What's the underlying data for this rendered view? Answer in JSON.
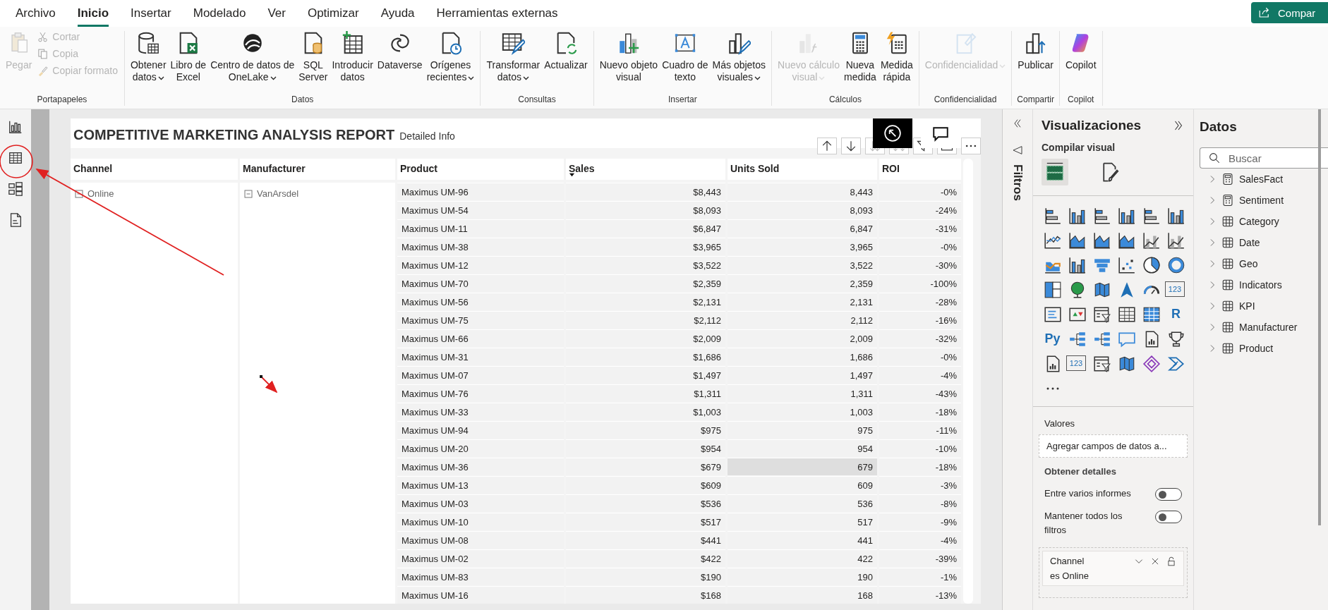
{
  "menu": {
    "tabs": [
      {
        "label": "Archivo",
        "selected": false
      },
      {
        "label": "Inicio",
        "selected": true
      },
      {
        "label": "Insertar",
        "selected": false
      },
      {
        "label": "Modelado",
        "selected": false
      },
      {
        "label": "Ver",
        "selected": false
      },
      {
        "label": "Optimizar",
        "selected": false
      },
      {
        "label": "Ayuda",
        "selected": false
      },
      {
        "label": "Herramientas externas",
        "selected": false
      }
    ],
    "share_button": "Compar"
  },
  "ribbon": {
    "groups": [
      {
        "label": "Portapapeles",
        "buttons": [
          {
            "lines": [
              "Pegar"
            ],
            "kind": "large",
            "disabled": true,
            "dropdown": false
          },
          {
            "lines": [
              "Cortar"
            ],
            "kind": "small",
            "disabled": true,
            "dropdown": false
          },
          {
            "lines": [
              "Copia"
            ],
            "kind": "small",
            "disabled": true,
            "dropdown": false
          },
          {
            "lines": [
              "Copiar formato"
            ],
            "kind": "small",
            "disabled": true,
            "dropdown": false
          }
        ]
      },
      {
        "label": "Datos",
        "buttons": [
          {
            "lines": [
              "Obtener",
              "datos"
            ],
            "kind": "large",
            "disabled": false,
            "dropdown": true
          },
          {
            "lines": [
              "Libro de",
              "Excel"
            ],
            "kind": "large",
            "disabled": false,
            "dropdown": false
          },
          {
            "lines": [
              "Centro de datos de",
              "OneLake"
            ],
            "kind": "large",
            "disabled": false,
            "dropdown": true
          },
          {
            "lines": [
              "SQL",
              "Server"
            ],
            "kind": "large",
            "disabled": false,
            "dropdown": false
          },
          {
            "lines": [
              "Introducir",
              "datos"
            ],
            "kind": "large",
            "disabled": false,
            "dropdown": false
          },
          {
            "lines": [
              "Dataverse"
            ],
            "kind": "large",
            "disabled": false,
            "dropdown": false
          },
          {
            "lines": [
              "Orígenes",
              "recientes"
            ],
            "kind": "large",
            "disabled": false,
            "dropdown": true
          }
        ]
      },
      {
        "label": "Consultas",
        "buttons": [
          {
            "lines": [
              "Transformar",
              "datos"
            ],
            "kind": "large",
            "disabled": false,
            "dropdown": true
          },
          {
            "lines": [
              "Actualizar"
            ],
            "kind": "large",
            "disabled": false,
            "dropdown": false
          }
        ]
      },
      {
        "label": "Insertar",
        "buttons": [
          {
            "lines": [
              "Nuevo objeto",
              "visual"
            ],
            "kind": "large",
            "disabled": false,
            "dropdown": false
          },
          {
            "lines": [
              "Cuadro de",
              "texto"
            ],
            "kind": "large",
            "disabled": false,
            "dropdown": false
          },
          {
            "lines": [
              "Más objetos",
              "visuales"
            ],
            "kind": "large",
            "disabled": false,
            "dropdown": true
          }
        ]
      },
      {
        "label": "Cálculos",
        "buttons": [
          {
            "lines": [
              "Nuevo cálculo",
              "visual"
            ],
            "kind": "large",
            "disabled": true,
            "dropdown": true
          },
          {
            "lines": [
              "Nueva",
              "medida"
            ],
            "kind": "large",
            "disabled": false,
            "dropdown": false
          },
          {
            "lines": [
              "Medida",
              "rápida"
            ],
            "kind": "large",
            "disabled": false,
            "dropdown": false
          }
        ]
      },
      {
        "label": "Confidencialidad",
        "buttons": [
          {
            "lines": [
              "Confidencialidad"
            ],
            "kind": "large",
            "disabled": true,
            "dropdown": true
          }
        ]
      },
      {
        "label": "Compartir",
        "buttons": [
          {
            "lines": [
              "Publicar"
            ],
            "kind": "large",
            "disabled": false,
            "dropdown": false
          }
        ]
      },
      {
        "label": "Copilot",
        "buttons": [
          {
            "lines": [
              "Copilot"
            ],
            "kind": "large",
            "disabled": false,
            "dropdown": false
          }
        ]
      }
    ]
  },
  "report": {
    "title": "COMPETITIVE MARKETING ANALYSIS REPORT",
    "subtitle": "Detailed Info",
    "table": {
      "columns": [
        {
          "label": "Channel",
          "sorted_descending": false
        },
        {
          "label": "Manufacturer",
          "sorted_descending": false
        },
        {
          "label": "Product",
          "sorted_descending": false
        },
        {
          "label": "Sales",
          "sorted_descending": true
        },
        {
          "label": "Units Sold",
          "sorted_descending": false
        },
        {
          "label": "ROI",
          "sorted_descending": false
        }
      ],
      "channel": {
        "value": "Online",
        "expanded": true
      },
      "manufacturer": {
        "value": "VanArsdel",
        "expanded": true
      },
      "rows": [
        {
          "product": "Maximus UM-96",
          "sales": "$8,443",
          "units": "8,443",
          "roi": "-0%",
          "highlighted": false
        },
        {
          "product": "Maximus UM-54",
          "sales": "$8,093",
          "units": "8,093",
          "roi": "-24%",
          "highlighted": false
        },
        {
          "product": "Maximus UM-11",
          "sales": "$6,847",
          "units": "6,847",
          "roi": "-31%",
          "highlighted": false
        },
        {
          "product": "Maximus UM-38",
          "sales": "$3,965",
          "units": "3,965",
          "roi": "-0%",
          "highlighted": false
        },
        {
          "product": "Maximus UM-12",
          "sales": "$3,522",
          "units": "3,522",
          "roi": "-30%",
          "highlighted": false
        },
        {
          "product": "Maximus UM-70",
          "sales": "$2,359",
          "units": "2,359",
          "roi": "-100%",
          "highlighted": false
        },
        {
          "product": "Maximus UM-56",
          "sales": "$2,131",
          "units": "2,131",
          "roi": "-28%",
          "highlighted": false
        },
        {
          "product": "Maximus UM-75",
          "sales": "$2,112",
          "units": "2,112",
          "roi": "-16%",
          "highlighted": false
        },
        {
          "product": "Maximus UM-66",
          "sales": "$2,009",
          "units": "2,009",
          "roi": "-32%",
          "highlighted": false
        },
        {
          "product": "Maximus UM-31",
          "sales": "$1,686",
          "units": "1,686",
          "roi": "-0%",
          "highlighted": false
        },
        {
          "product": "Maximus UM-07",
          "sales": "$1,497",
          "units": "1,497",
          "roi": "-4%",
          "highlighted": false
        },
        {
          "product": "Maximus UM-76",
          "sales": "$1,311",
          "units": "1,311",
          "roi": "-43%",
          "highlighted": false
        },
        {
          "product": "Maximus UM-33",
          "sales": "$1,003",
          "units": "1,003",
          "roi": "-18%",
          "highlighted": false
        },
        {
          "product": "Maximus UM-94",
          "sales": "$975",
          "units": "975",
          "roi": "-11%",
          "highlighted": false
        },
        {
          "product": "Maximus UM-20",
          "sales": "$954",
          "units": "954",
          "roi": "-10%",
          "highlighted": false
        },
        {
          "product": "Maximus UM-36",
          "sales": "$679",
          "units": "679",
          "roi": "-18%",
          "highlighted": true
        },
        {
          "product": "Maximus UM-13",
          "sales": "$609",
          "units": "609",
          "roi": "-3%",
          "highlighted": false
        },
        {
          "product": "Maximus UM-03",
          "sales": "$536",
          "units": "536",
          "roi": "-8%",
          "highlighted": false
        },
        {
          "product": "Maximus UM-10",
          "sales": "$517",
          "units": "517",
          "roi": "-9%",
          "highlighted": false
        },
        {
          "product": "Maximus UM-08",
          "sales": "$441",
          "units": "441",
          "roi": "-4%",
          "highlighted": false
        },
        {
          "product": "Maximus UM-02",
          "sales": "$422",
          "units": "422",
          "roi": "-39%",
          "highlighted": false
        },
        {
          "product": "Maximus UM-83",
          "sales": "$190",
          "units": "190",
          "roi": "-1%",
          "highlighted": false
        },
        {
          "product": "Maximus UM-16",
          "sales": "$168",
          "units": "168",
          "roi": "-13%",
          "highlighted": false
        }
      ]
    }
  },
  "filters_pane": {
    "title": "Filtros"
  },
  "visualizations": {
    "title": "Visualizaciones",
    "subtitle": "Compilar visual",
    "tabs": [
      {
        "selected": true
      },
      {
        "selected": false
      }
    ],
    "visual_types": [
      {
        "kind": "hbar"
      },
      {
        "kind": "vbar"
      },
      {
        "kind": "hbar"
      },
      {
        "kind": "vbar"
      },
      {
        "kind": "hbar"
      },
      {
        "kind": "vbar"
      },
      {
        "kind": "line"
      },
      {
        "kind": "area"
      },
      {
        "kind": "area"
      },
      {
        "kind": "area"
      },
      {
        "kind": "combo"
      },
      {
        "kind": "combo"
      },
      {
        "kind": "ribbon"
      },
      {
        "kind": "vbar"
      },
      {
        "kind": "funnel"
      },
      {
        "kind": "scatter"
      },
      {
        "kind": "pie"
      },
      {
        "kind": "donut"
      },
      {
        "kind": "treemap"
      },
      {
        "kind": "globe"
      },
      {
        "kind": "map"
      },
      {
        "kind": "arrow"
      },
      {
        "kind": "gauge"
      },
      {
        "kind": "card",
        "glyph": "123"
      },
      {
        "kind": "list"
      },
      {
        "kind": "kpi"
      },
      {
        "kind": "slicer"
      },
      {
        "kind": "table"
      },
      {
        "kind": "matrix"
      },
      {
        "kind": "glyph",
        "glyph": "R"
      },
      {
        "kind": "glyph",
        "glyph": "Py"
      },
      {
        "kind": "tree"
      },
      {
        "kind": "tree"
      },
      {
        "kind": "speech"
      },
      {
        "kind": "doc"
      },
      {
        "kind": "trophy"
      },
      {
        "kind": "doc"
      },
      {
        "kind": "card",
        "glyph": "123"
      },
      {
        "kind": "slicer"
      },
      {
        "kind": "map"
      },
      {
        "kind": "diamond"
      },
      {
        "kind": "chevrons"
      }
    ],
    "values_label": "Valores",
    "values_hint": "Agregar campos de datos a...",
    "drillthrough_title": "Obtener detalles",
    "toggles": [
      {
        "label": "Entre varios informes",
        "on": false
      },
      {
        "label": "Mantener todos los filtros",
        "on": false
      }
    ],
    "filter_card": {
      "field": "Channel",
      "condition": "es Online"
    }
  },
  "data_pane": {
    "title": "Datos",
    "search": {
      "placeholder": "Buscar"
    },
    "tables": [
      {
        "name": "SalesFact",
        "kind": "measure",
        "expanded": false
      },
      {
        "name": "Sentiment",
        "kind": "measure",
        "expanded": false
      },
      {
        "name": "Category",
        "kind": "table",
        "expanded": false
      },
      {
        "name": "Date",
        "kind": "table",
        "expanded": false
      },
      {
        "name": "Geo",
        "kind": "table",
        "expanded": false
      },
      {
        "name": "Indicators",
        "kind": "table",
        "expanded": false
      },
      {
        "name": "KPI",
        "kind": "table",
        "expanded": false
      },
      {
        "name": "Manufacturer",
        "kind": "table",
        "expanded": false
      },
      {
        "name": "Product",
        "kind": "table",
        "expanded": false
      }
    ]
  }
}
